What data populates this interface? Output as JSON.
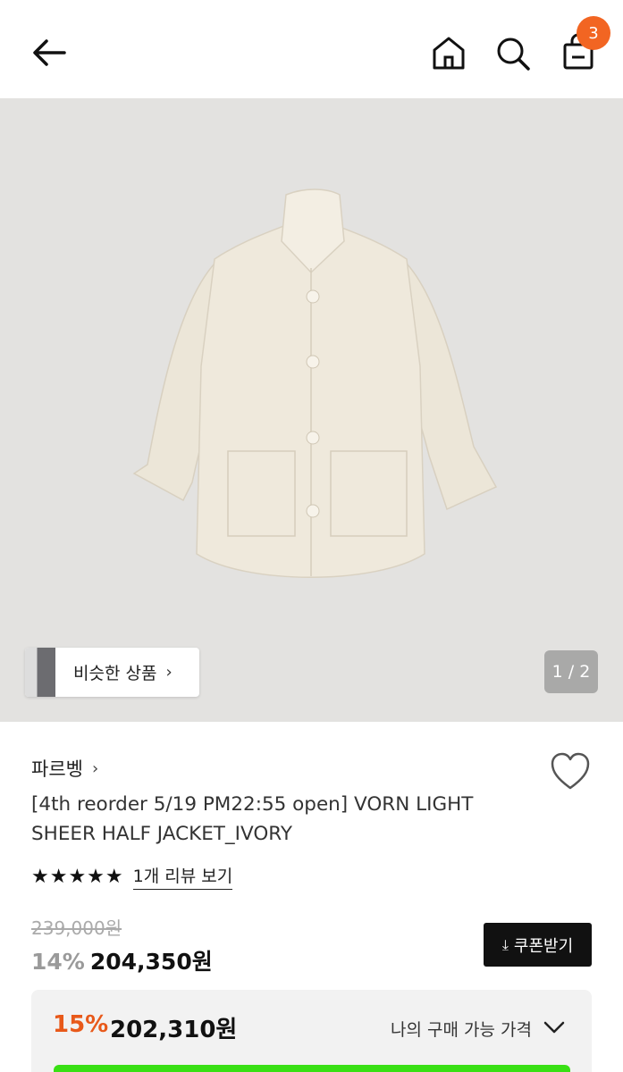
{
  "header": {
    "cart_count": "3"
  },
  "hero": {
    "similar_label": "비슷한 상품",
    "pager": "1 / 2"
  },
  "product": {
    "brand": "파르벵",
    "title": "[4th reorder 5/19 PM22:55 open] VORN LIGHT SHEER HALF JACKET_IVORY",
    "rating_stars": 5,
    "review_link": "1개 리뷰 보기",
    "original_price": "239,000원",
    "discount": "14%",
    "price": "204,350원",
    "coupon_label": "쿠폰받기"
  },
  "my_price": {
    "discount": "15%",
    "price": "202,310원",
    "label": "나의 구매 가능 가격"
  },
  "colors": {
    "accent": "#f26522",
    "discount_orange": "#e8591a",
    "button_dark": "#111111",
    "green_bar": "#39e014"
  },
  "icons": [
    "back-arrow-icon",
    "home-icon",
    "search-icon",
    "shopping-bag-icon",
    "heart-icon",
    "chevron-right-icon",
    "download-icon",
    "chevron-down-icon"
  ]
}
